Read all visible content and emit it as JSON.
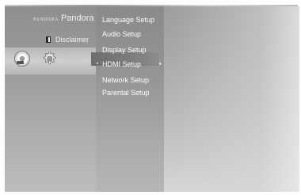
{
  "left_menu": {
    "pandora": {
      "brand_small": "PANDORA",
      "label": "Pandora",
      "icon": "pandora-logo"
    },
    "disclaimer": {
      "label": "Disclaimer",
      "icon": "document-icon"
    },
    "setup": {
      "label": "Setup",
      "icon": "gear-icon",
      "disc_icon": "disc-icon"
    }
  },
  "setup_menu": {
    "items": [
      {
        "label": "Language Setup"
      },
      {
        "label": "Audio Setup"
      },
      {
        "label": "Display Setup"
      },
      {
        "label": "HDMI Setup",
        "selected": true
      },
      {
        "label": "Network Setup"
      },
      {
        "label": "Parental Setup"
      }
    ],
    "selected_bullet": "•",
    "selected_arrow": "▸"
  },
  "colors": {
    "menu_text": "#ffffff",
    "selected_bar": "#7a7a7a",
    "background_gray": "#a8a8a8"
  }
}
